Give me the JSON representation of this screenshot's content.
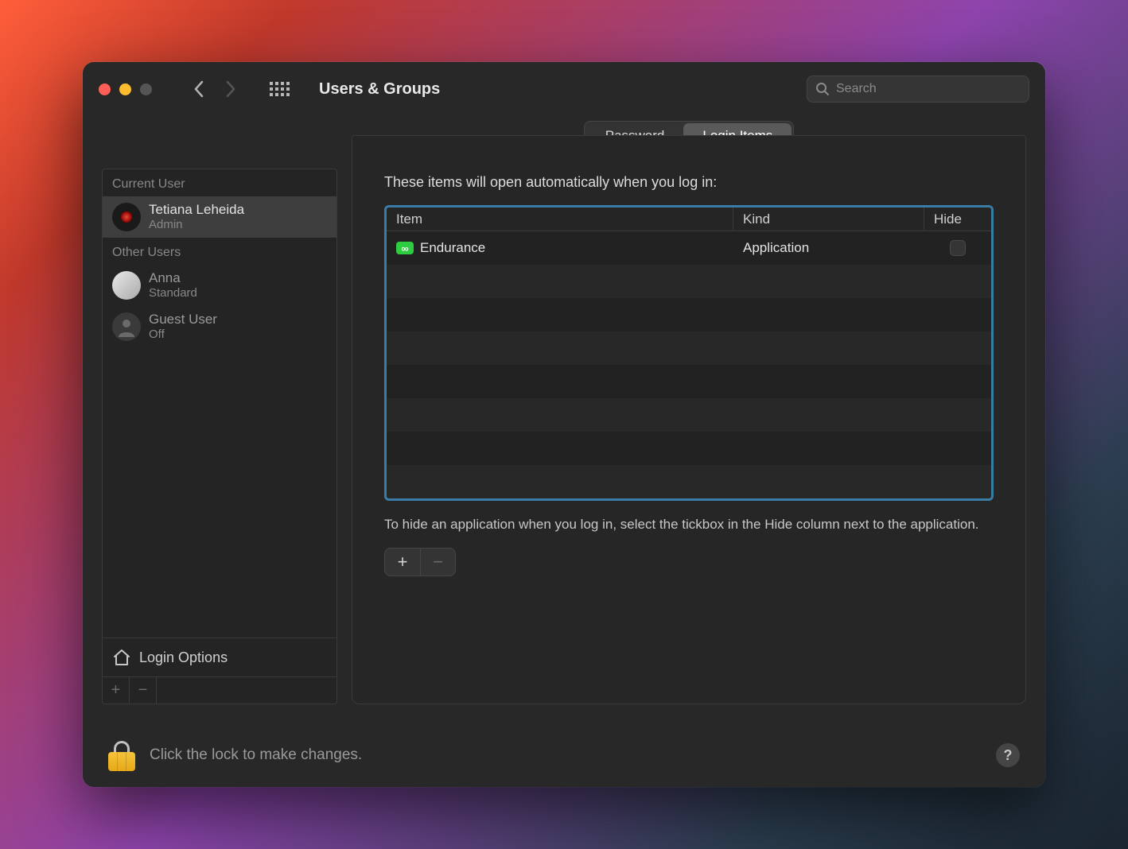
{
  "window": {
    "title": "Users & Groups"
  },
  "search": {
    "placeholder": "Search"
  },
  "sidebar": {
    "section_current": "Current User",
    "section_other": "Other Users",
    "current_user": {
      "name": "Tetiana Leheida",
      "role": "Admin"
    },
    "others": [
      {
        "name": "Anna",
        "role": "Standard"
      },
      {
        "name": "Guest User",
        "role": "Off"
      }
    ],
    "login_options": "Login Options"
  },
  "tabs": {
    "password": "Password",
    "login_items": "Login Items"
  },
  "panel": {
    "intro": "These items will open automatically when you log in:",
    "columns": {
      "item": "Item",
      "kind": "Kind",
      "hide": "Hide"
    },
    "rows": [
      {
        "name": "Endurance",
        "kind": "Application",
        "hide": false,
        "icon_glyph": "∞"
      }
    ],
    "hint": "To hide an application when you log in, select the tickbox in the Hide column next to the application."
  },
  "footer": {
    "lock_text": "Click the lock to make changes.",
    "help": "?"
  }
}
